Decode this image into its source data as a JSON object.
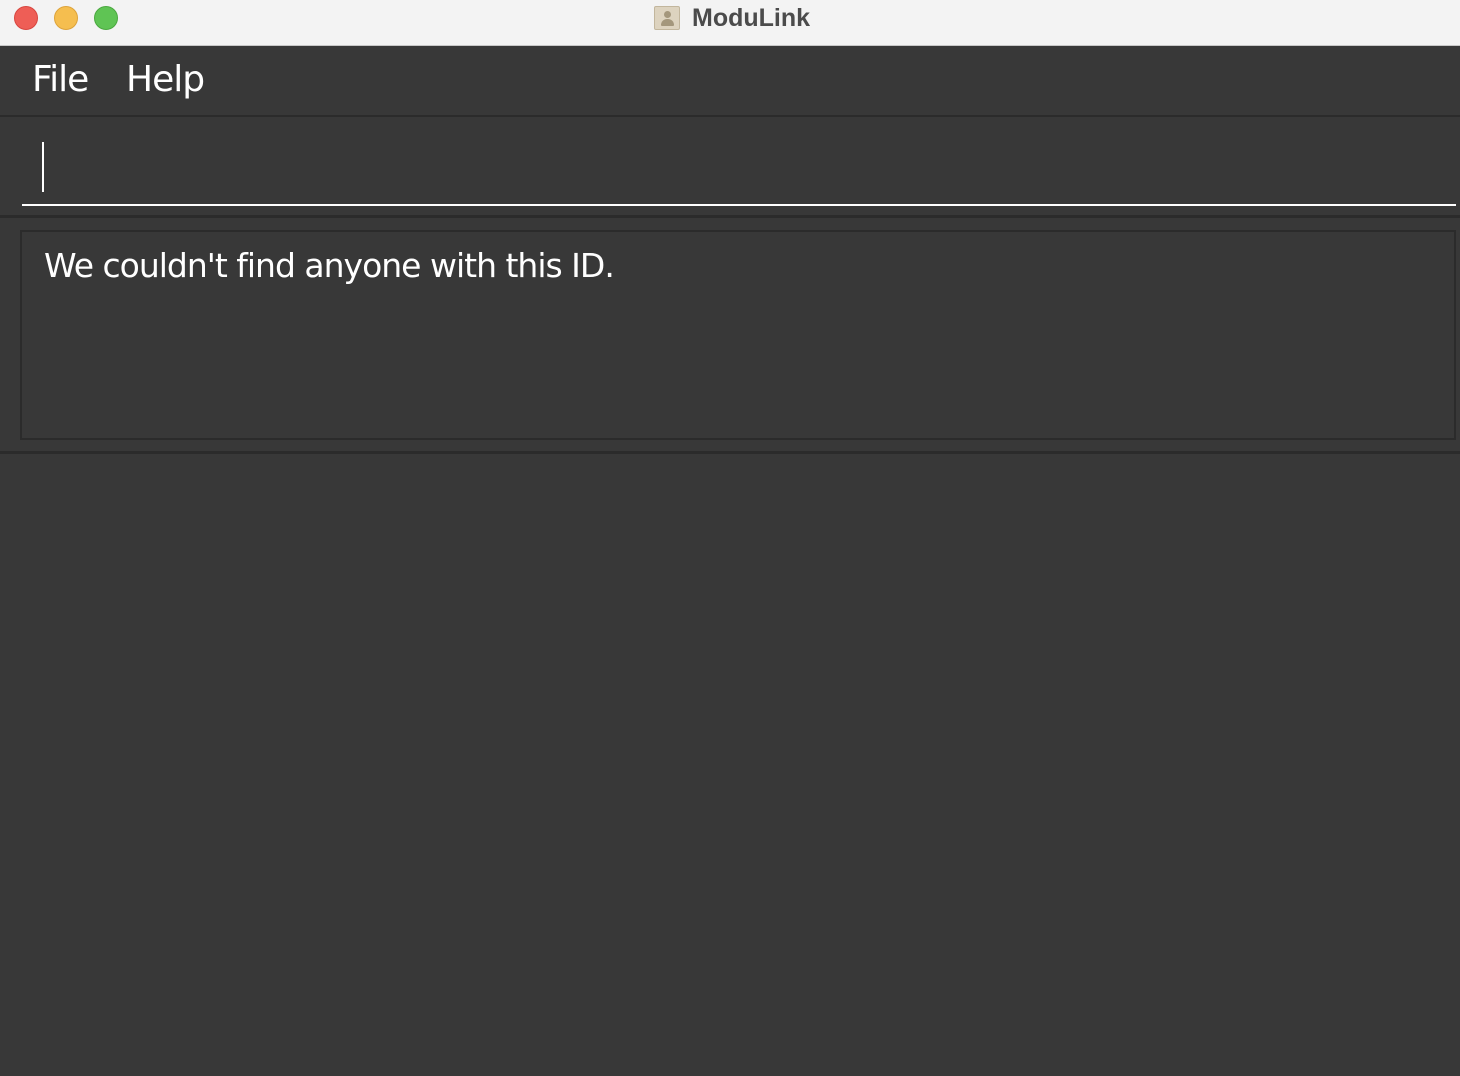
{
  "window": {
    "title": "ModuLink",
    "app_icon": "address-book-icon"
  },
  "menubar": {
    "items": [
      {
        "label": "File"
      },
      {
        "label": "Help"
      }
    ]
  },
  "command_box": {
    "value": "",
    "placeholder": ""
  },
  "result_display": {
    "message": "We couldn't find anyone with this ID."
  },
  "colors": {
    "background": "#383838",
    "border_dark": "#2b2b2b",
    "text": "#ffffff",
    "titlebar": "#f3f3f3",
    "close": "#ee5e56",
    "minimize": "#f5be4f",
    "maximize": "#5fc454"
  }
}
